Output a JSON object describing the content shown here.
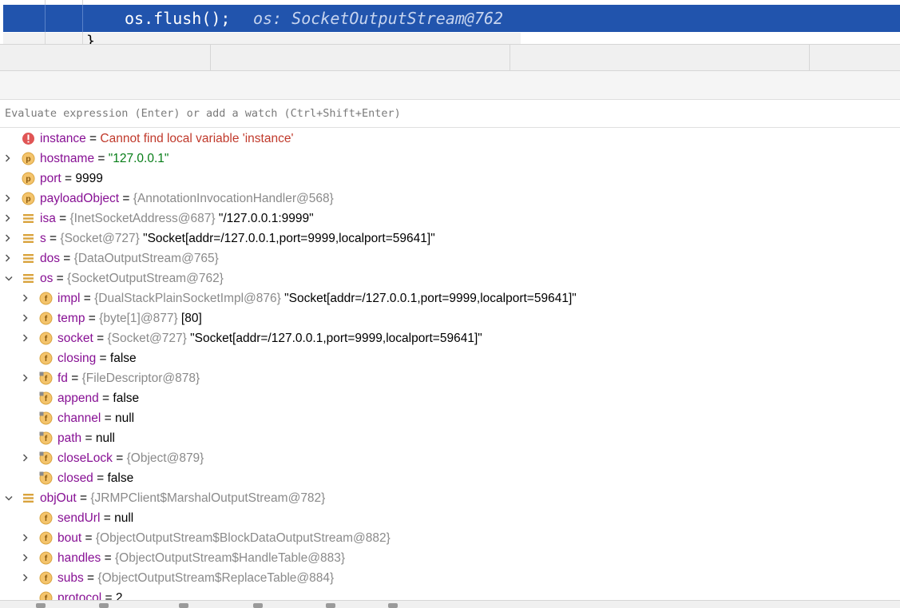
{
  "editor": {
    "current_line_code": "os.flush();",
    "current_line_hint": "os: SocketOutputStream@762",
    "next_line_code": "}"
  },
  "evaluate": {
    "placeholder": "Evaluate expression (Enter) or add a watch (Ctrl+Shift+Enter)"
  },
  "colors": {
    "execution_line": "#2154ad",
    "variable_name": "#871094",
    "string_value": "#067d17",
    "error_text": "#c0392b",
    "object_ref": "#8a8a8a"
  },
  "variables": [
    {
      "level": 0,
      "expand": "none",
      "icon": "error-icon",
      "name": "instance",
      "eq": " = ",
      "error": "Cannot find local variable 'instance'"
    },
    {
      "level": 0,
      "expand": "collapsed",
      "icon": "parameter-icon",
      "name": "hostname",
      "eq": " = ",
      "str": "\"127.0.0.1\""
    },
    {
      "level": 0,
      "expand": "none",
      "icon": "parameter-icon",
      "name": "port",
      "eq": " = ",
      "val": "9999"
    },
    {
      "level": 0,
      "expand": "collapsed",
      "icon": "parameter-icon",
      "name": "payloadObject",
      "eq": " = ",
      "ref": "{AnnotationInvocationHandler@568}"
    },
    {
      "level": 0,
      "expand": "collapsed",
      "icon": "local-variable-icon",
      "name": "isa",
      "eq": " = ",
      "ref": "{InetSocketAddress@687}",
      "val": " \"/127.0.0.1:9999\""
    },
    {
      "level": 0,
      "expand": "collapsed",
      "icon": "local-variable-icon",
      "name": "s",
      "eq": " = ",
      "ref": "{Socket@727}",
      "val": " \"Socket[addr=/127.0.0.1,port=9999,localport=59641]\""
    },
    {
      "level": 0,
      "expand": "collapsed",
      "icon": "local-variable-icon",
      "name": "dos",
      "eq": " = ",
      "ref": "{DataOutputStream@765}"
    },
    {
      "level": 0,
      "expand": "expanded",
      "icon": "local-variable-icon",
      "name": "os",
      "eq": " = ",
      "ref": "{SocketOutputStream@762}"
    },
    {
      "level": 1,
      "expand": "collapsed",
      "icon": "field-icon",
      "name": "impl",
      "eq": " = ",
      "ref": "{DualStackPlainSocketImpl@876}",
      "val": " \"Socket[addr=/127.0.0.1,port=9999,localport=59641]\""
    },
    {
      "level": 1,
      "expand": "collapsed",
      "icon": "field-icon",
      "name": "temp",
      "eq": " = ",
      "ref": "{byte[1]@877}",
      "val": " [80]"
    },
    {
      "level": 1,
      "expand": "collapsed",
      "icon": "field-icon",
      "name": "socket",
      "eq": " = ",
      "ref": "{Socket@727}",
      "val": " \"Socket[addr=/127.0.0.1,port=9999,localport=59641]\""
    },
    {
      "level": 1,
      "expand": "none",
      "icon": "field-icon",
      "name": "closing",
      "eq": " = ",
      "val": "false"
    },
    {
      "level": 1,
      "expand": "collapsed",
      "icon": "inherited-field-icon",
      "name": "fd",
      "eq": " = ",
      "ref": "{FileDescriptor@878}"
    },
    {
      "level": 1,
      "expand": "none",
      "icon": "inherited-field-icon",
      "name": "append",
      "eq": " = ",
      "val": "false"
    },
    {
      "level": 1,
      "expand": "none",
      "icon": "inherited-field-icon",
      "name": "channel",
      "eq": " = ",
      "val": "null"
    },
    {
      "level": 1,
      "expand": "none",
      "icon": "inherited-field-icon",
      "name": "path",
      "eq": " = ",
      "val": "null"
    },
    {
      "level": 1,
      "expand": "collapsed",
      "icon": "inherited-field-icon",
      "name": "closeLock",
      "eq": " = ",
      "ref": "{Object@879}"
    },
    {
      "level": 1,
      "expand": "none",
      "icon": "inherited-field-icon",
      "name": "closed",
      "eq": " = ",
      "val": "false"
    },
    {
      "level": 0,
      "expand": "expanded",
      "icon": "local-variable-icon",
      "name": "objOut",
      "eq": " = ",
      "ref": "{JRMPClient$MarshalOutputStream@782}"
    },
    {
      "level": 1,
      "expand": "none",
      "icon": "field-icon",
      "name": "sendUrl",
      "eq": " = ",
      "val": "null"
    },
    {
      "level": 1,
      "expand": "collapsed",
      "icon": "field-icon",
      "name": "bout",
      "eq": " = ",
      "ref": "{ObjectOutputStream$BlockDataOutputStream@882}"
    },
    {
      "level": 1,
      "expand": "collapsed",
      "icon": "field-icon",
      "name": "handles",
      "eq": " = ",
      "ref": "{ObjectOutputStream$HandleTable@883}"
    },
    {
      "level": 1,
      "expand": "collapsed",
      "icon": "field-icon",
      "name": "subs",
      "eq": " = ",
      "ref": "{ObjectOutputStream$ReplaceTable@884}"
    },
    {
      "level": 1,
      "expand": "none",
      "icon": "field-icon",
      "name": "protocol",
      "eq": " = ",
      "val": "2"
    }
  ]
}
